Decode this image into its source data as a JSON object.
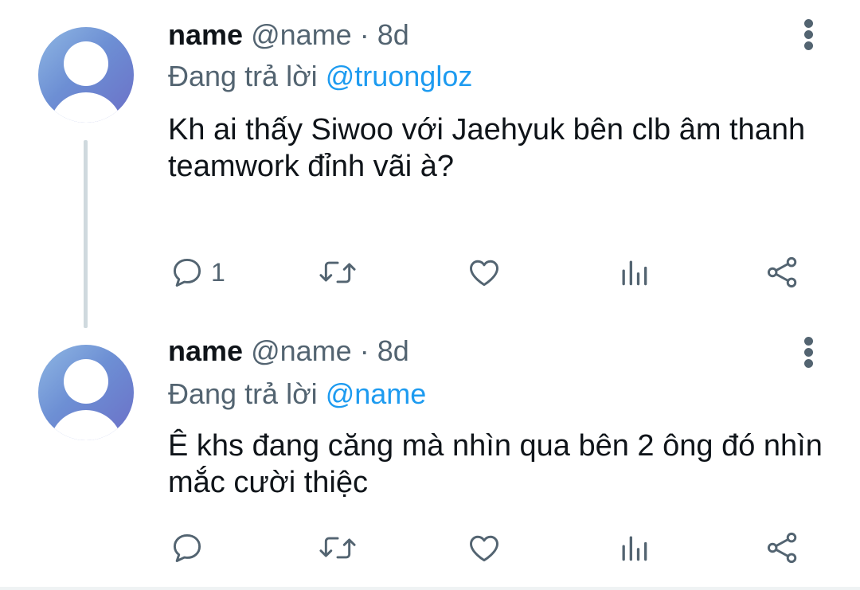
{
  "tweets": [
    {
      "display_name": "name",
      "handle": "@name",
      "separator": "·",
      "time": "8d",
      "replying_prefix": "Đang trả lời",
      "replying_to": "@truongloz",
      "text": "Kh ai thấy Siwoo với Jaehyuk bên clb âm thanh teamwork đỉnh vãi à?",
      "reply_count": "1",
      "icons": [
        "reply-icon",
        "retweet-icon",
        "like-icon",
        "views-icon",
        "share-icon",
        "more-icon"
      ]
    },
    {
      "display_name": "name",
      "handle": "@name",
      "separator": "·",
      "time": "8d",
      "replying_prefix": "Đang trả lời",
      "replying_to": "@name",
      "text": "Ê khs đang căng mà nhìn qua bên 2 ông đó nhìn mắc cười thiệc",
      "reply_count": "",
      "icons": [
        "reply-icon",
        "retweet-icon",
        "like-icon",
        "views-icon",
        "share-icon",
        "more-icon"
      ]
    }
  ],
  "colors": {
    "text_primary": "#0f1419",
    "text_secondary": "#536471",
    "link": "#1d9bf0",
    "thread_line": "#cfd9de"
  }
}
